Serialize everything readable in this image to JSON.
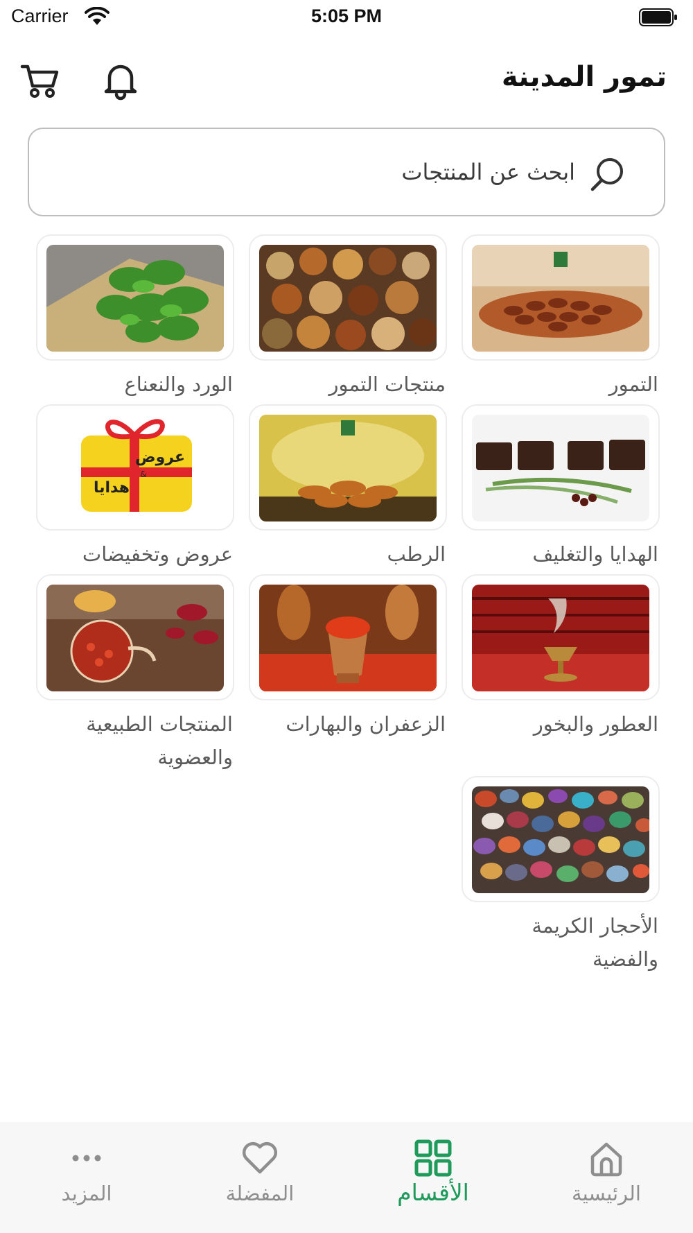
{
  "status_bar": {
    "carrier": "Carrier",
    "time": "5:05 PM"
  },
  "header": {
    "title": "تمور المدينة",
    "cart_icon": "cart-icon",
    "bell_icon": "bell-icon"
  },
  "search": {
    "placeholder": "ابحث عن المنتجات",
    "icon": "search-icon"
  },
  "categories": [
    {
      "label": "التمور"
    },
    {
      "label": "منتجات التمور"
    },
    {
      "label": "الورد والنعناع"
    },
    {
      "label": "الهدايا والتغليف"
    },
    {
      "label": "الرطب"
    },
    {
      "label": "عروض وتخفيضات"
    },
    {
      "label": "العطور والبخور"
    },
    {
      "label": "الزعفران والبهارات"
    },
    {
      "label": "المنتجات الطبيعية والعضوية"
    },
    {
      "label": "الأحجار الكريمة والفضية"
    }
  ],
  "offers_badge": {
    "line1": "عروض",
    "amp": "&",
    "line2": "هدايا"
  },
  "tabs": [
    {
      "label": "الرئيسية",
      "icon": "home-icon"
    },
    {
      "label": "الأقسام",
      "icon": "grid-icon",
      "active": true
    },
    {
      "label": "المفضلة",
      "icon": "heart-icon"
    },
    {
      "label": "المزيد",
      "icon": "more-icon"
    }
  ],
  "colors": {
    "accent": "#1e9a5a",
    "inactive": "#8e8e8e",
    "tab_bar_bg": "#f7f7f7"
  }
}
